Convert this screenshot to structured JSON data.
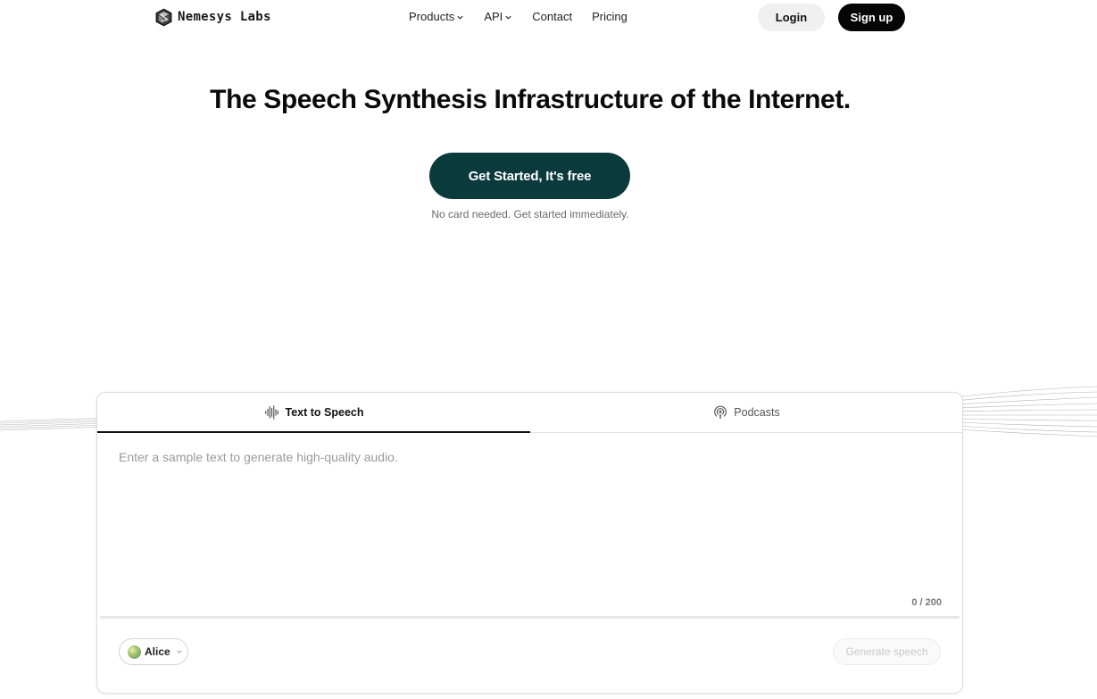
{
  "brand": {
    "name": "Nemesys Labs",
    "logo_icon": "cube-logo-icon"
  },
  "nav": {
    "links": [
      {
        "label": "Products",
        "has_dropdown": true
      },
      {
        "label": "API",
        "has_dropdown": true
      },
      {
        "label": "Contact",
        "has_dropdown": false
      },
      {
        "label": "Pricing",
        "has_dropdown": false
      }
    ],
    "login_label": "Login",
    "signup_label": "Sign up"
  },
  "hero": {
    "title": "The Speech Synthesis Infrastructure of the Internet.",
    "cta_label": "Get Started, It's free",
    "cta_note": "No card needed. Get started immediately."
  },
  "demo": {
    "tabs": [
      {
        "label": "Text to Speech",
        "icon": "waveform-icon",
        "active": true
      },
      {
        "label": "Podcasts",
        "icon": "podcast-icon",
        "active": false
      }
    ],
    "input": {
      "value": "",
      "placeholder": "Enter a sample text to generate high-quality audio."
    },
    "char_count": "0 / 200",
    "voice": {
      "name": "Alice",
      "icon": "chevron-down-icon"
    },
    "generate_label": "Generate speech"
  },
  "colors": {
    "cta_background": "#0b3a3c",
    "signup_background": "#050505",
    "login_background": "#f0f0f0"
  }
}
